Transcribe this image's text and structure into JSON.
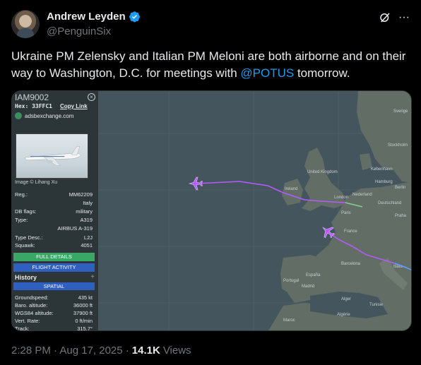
{
  "author": {
    "display_name": "Andrew Leyden",
    "handle": "@PenguinSix"
  },
  "tweet": {
    "text_before": "Ukraine PM Zelensky and Italian PM Meloni are both airborne and on their way to Washington, D.C. for meetings with ",
    "mention": "@POTUS",
    "text_after": " tomorrow."
  },
  "panel": {
    "callsign": "IAM9002",
    "hex_label": "Hex: 33FFC1",
    "copy_link": "Copy Link",
    "site": "adsbexchange.com",
    "image_credit": "Image © Lihang Xu",
    "fields": [
      {
        "k": "Reg.:",
        "v": "MM62209"
      },
      {
        "k": "",
        "v": "Italy"
      },
      {
        "k": "DB flags:",
        "v": "military"
      },
      {
        "k": "Type:",
        "v": "A319"
      },
      {
        "k": "",
        "v": "AIRBUS A-319"
      },
      {
        "k": "Type Desc.:",
        "v": "L2J"
      },
      {
        "k": "Squawk:",
        "v": "4051"
      }
    ],
    "full_details": "FULL DETAILS",
    "flight_activity": "FLIGHT ACTIVITY",
    "history": "History",
    "spatial": "SPATIAL",
    "stats": [
      {
        "k": "Groundspeed:",
        "v": "435 kt"
      },
      {
        "k": "Baro. altitude:",
        "v": "36000 ft"
      },
      {
        "k": "WGS84 altitude:",
        "v": "37900 ft"
      },
      {
        "k": "Vert. Rate:",
        "v": "0 ft/min"
      },
      {
        "k": "Track:",
        "v": "315.7°"
      }
    ]
  },
  "map": {
    "labels": {
      "sverige": "Sverige",
      "united_kingdom": "United Kingdom",
      "ireland": "Ireland",
      "london": "London",
      "nederland": "Nederland",
      "hamburg": "Hamburg",
      "berlin": "Berlin",
      "deutschland": "Deutschland",
      "paris": "Paris",
      "france": "France",
      "espana": "España",
      "portugal": "Portugal",
      "barcelona": "Barcelona",
      "italia": "Italia",
      "madrid": "Madrid",
      "maroc": "Maroc",
      "algerie": "Algérie",
      "tunisie": "Tunisie",
      "alger": "Alger",
      "praha": "Praha",
      "stockholm": "Stockholm",
      "kobenhavn": "København"
    }
  },
  "footer": {
    "time": "2:28 PM · Aug 17, 2025 ·",
    "views_count": "14.1K",
    "views_label": "Views"
  },
  "colors": {
    "mention": "#1d9bf0",
    "track_purple": "#b35bff",
    "full_details_green": "#3aa767",
    "button_blue": "#2f5fbf"
  }
}
